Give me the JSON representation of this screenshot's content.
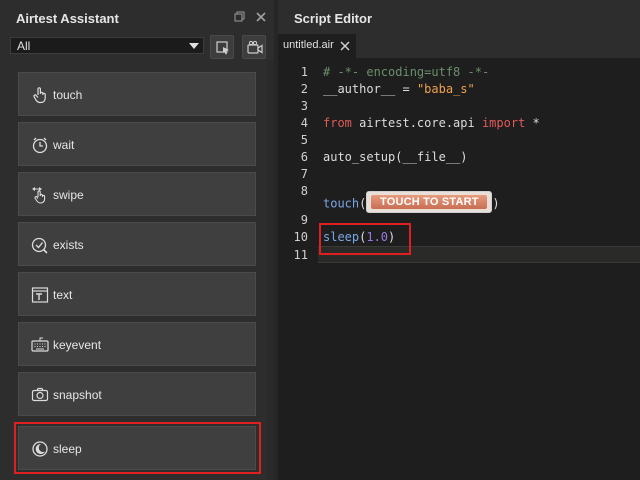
{
  "assistant": {
    "title": "Airtest Assistant",
    "filter_value": "All",
    "commands": [
      {
        "label": "touch",
        "icon": "touch-icon"
      },
      {
        "label": "wait",
        "icon": "clock-icon"
      },
      {
        "label": "swipe",
        "icon": "swipe-icon"
      },
      {
        "label": "exists",
        "icon": "check-circle-icon"
      },
      {
        "label": "text",
        "icon": "text-icon"
      },
      {
        "label": "keyevent",
        "icon": "keyboard-icon"
      },
      {
        "label": "snapshot",
        "icon": "camera-icon"
      },
      {
        "label": "sleep",
        "icon": "moon-icon"
      }
    ],
    "selected_command": "sleep"
  },
  "editor": {
    "title": "Script Editor",
    "tab_name": "untitled.air",
    "line_numbers": [
      "1",
      "2",
      "3",
      "4",
      "5",
      "6",
      "7",
      "8",
      "9",
      "10",
      "11"
    ],
    "lines": {
      "l1": "# -*- encoding=utf8 -*-",
      "l2_name": "__author__",
      "l2_eq": " = ",
      "l2_val": "\"baba_s\"",
      "l4_from": "from",
      "l4_mod": " airtest.core.api ",
      "l4_import": "import",
      "l4_star": " *",
      "l6": "auto_setup(__file__)",
      "l8_fn": "touch",
      "l8_open": "(",
      "l8_img_text": "TOUCH TO START",
      "l8_close": ")",
      "l10_fn": "sleep",
      "l10_open": "(",
      "l10_num": "1.0",
      "l10_close": ")"
    }
  },
  "colors": {
    "highlight": "#e02020",
    "keyword": "#e05a5a",
    "string": "#f0a050",
    "function": "#7aa7e8",
    "number": "#9b7ae0",
    "comment": "#6a8f6a"
  }
}
